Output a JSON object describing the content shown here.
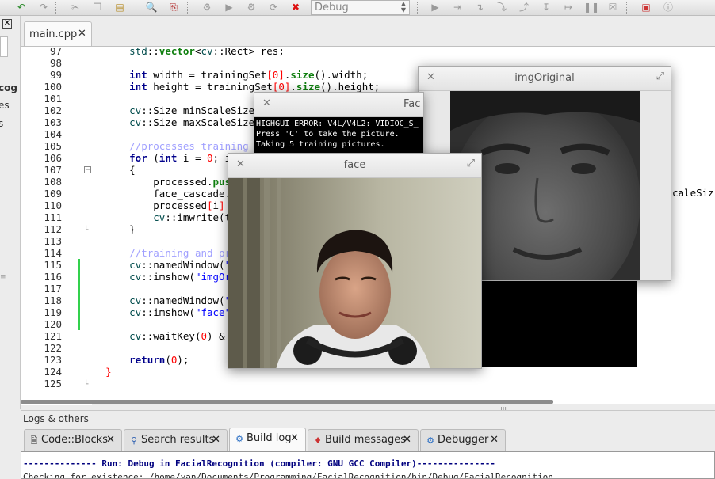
{
  "toolbar": {
    "config_select": "Debug"
  },
  "left_panel": {
    "fragments": [
      "cog",
      "es",
      "s"
    ]
  },
  "editor": {
    "file_tab": "main.cpp",
    "line_numbers": [
      "97",
      "98",
      "99",
      "100",
      "101",
      "102",
      "103",
      "104",
      "105",
      "106",
      "107",
      "108",
      "109",
      "110",
      "111",
      "112",
      "113",
      "114",
      "115",
      "116",
      "117",
      "118",
      "119",
      "120",
      "121",
      "122",
      "123",
      "124",
      "125"
    ],
    "changed_lines": [
      "115",
      "116",
      "117",
      "118",
      "119",
      "120"
    ],
    "right_fragment": "caleSiz"
  },
  "logs": {
    "header": "Logs & others",
    "tabs": [
      {
        "label": "Code::Blocks",
        "icon": "document-icon",
        "active": false
      },
      {
        "label": "Search results",
        "icon": "search-icon",
        "active": false
      },
      {
        "label": "Build log",
        "icon": "gear-icon",
        "active": true
      },
      {
        "label": "Build messages",
        "icon": "build-messages-icon",
        "active": false
      },
      {
        "label": "Debugger",
        "icon": "debugger-icon",
        "active": false
      }
    ],
    "lines": [
      "-------------- Run: Debug in FacialRecognition (compiler: GNU GCC Compiler)---------------",
      "Checking for existence: /home/yan/Documents/Programming/FacialRecognition/bin/Debug/FacialRecognition"
    ],
    "colors": {
      "run_line": "#00007f",
      "existence_line": "#222222"
    }
  },
  "windows": {
    "img_original": {
      "title": "imgOriginal"
    },
    "facial": {
      "title": "Fac",
      "terminal_lines": [
        "HIGHGUI ERROR: V4L/V4L2: VIDIOC_S_",
        "Press 'C' to take the picture.",
        "Taking 5 training pictures."
      ]
    },
    "face": {
      "title": "face"
    }
  }
}
